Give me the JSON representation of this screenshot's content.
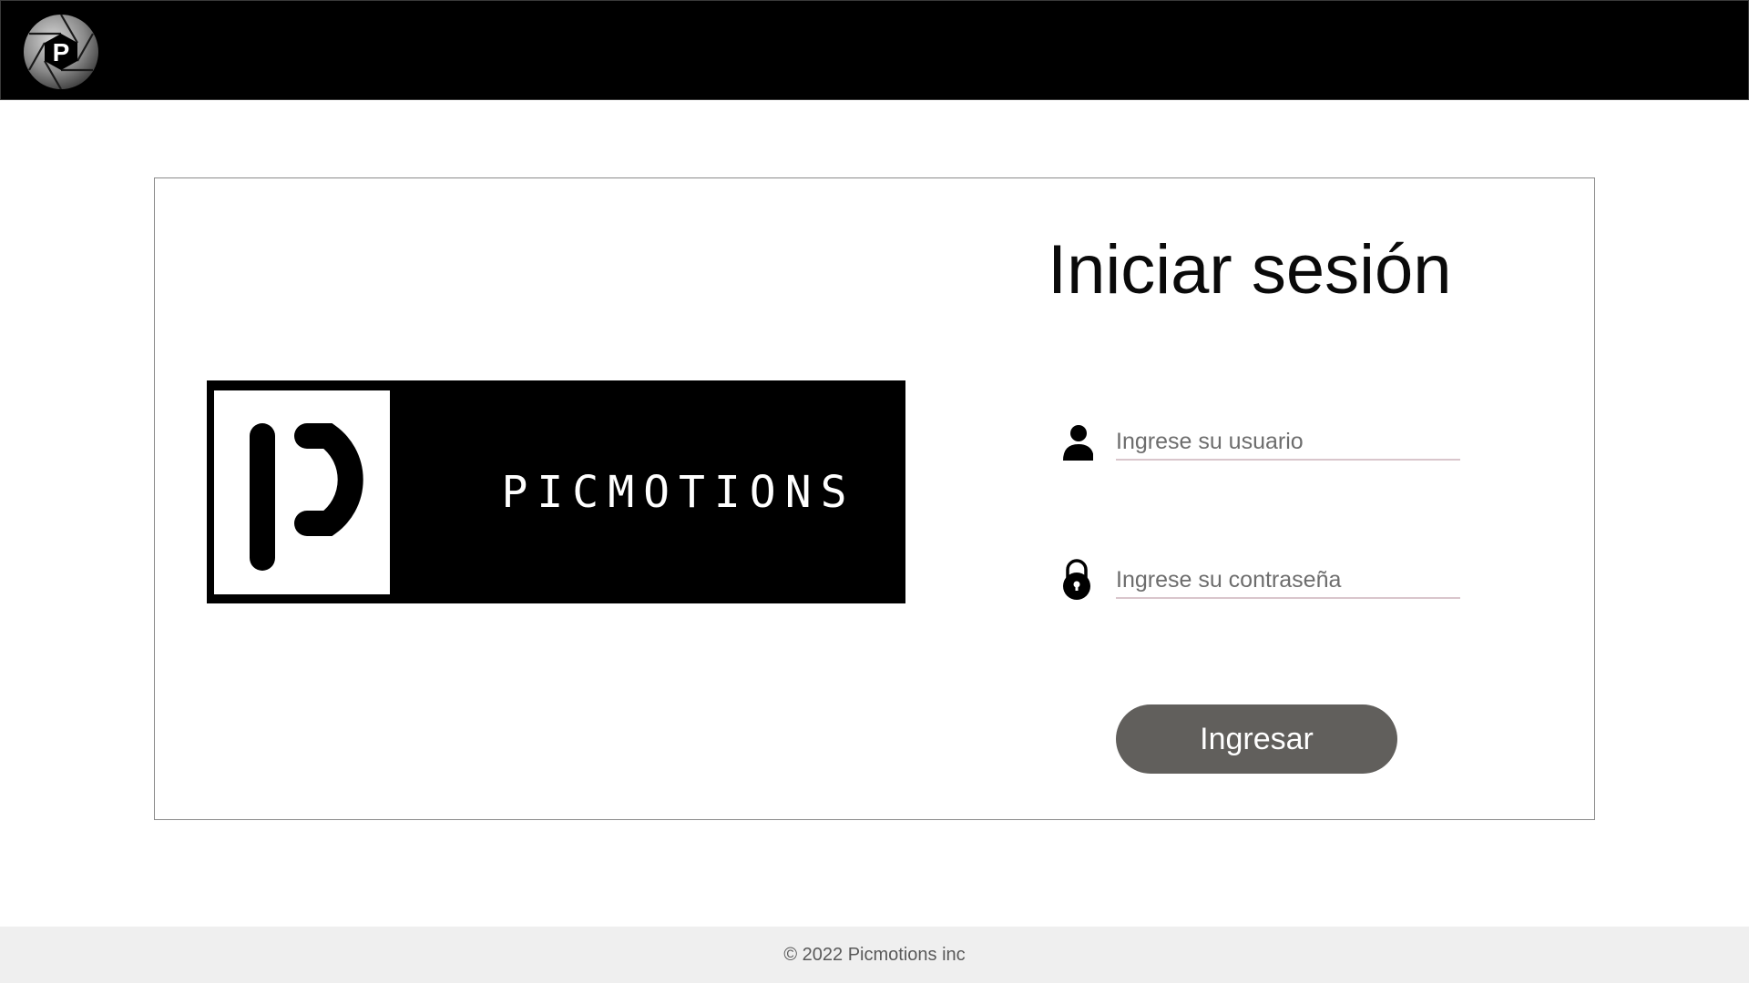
{
  "header": {
    "logo_icon": "aperture-logo-icon",
    "logo_letter": "P"
  },
  "brand": {
    "wordmark": "PICMOTIONS",
    "logo_icon": "picmotions-p-logo-icon"
  },
  "login": {
    "title": "Iniciar sesión",
    "username": {
      "icon": "user-icon",
      "value": "",
      "placeholder": "Ingrese su usuario"
    },
    "password": {
      "icon": "lock-icon",
      "value": "",
      "placeholder": "Ingrese su contraseña"
    },
    "submit_label": "Ingresar"
  },
  "footer": {
    "copyright": "© 2022 Picmotions inc"
  },
  "colors": {
    "topbar": "#000000",
    "button": "#615f5c",
    "input_underline": "#d9c6cc",
    "footer_bg": "#efefef"
  }
}
